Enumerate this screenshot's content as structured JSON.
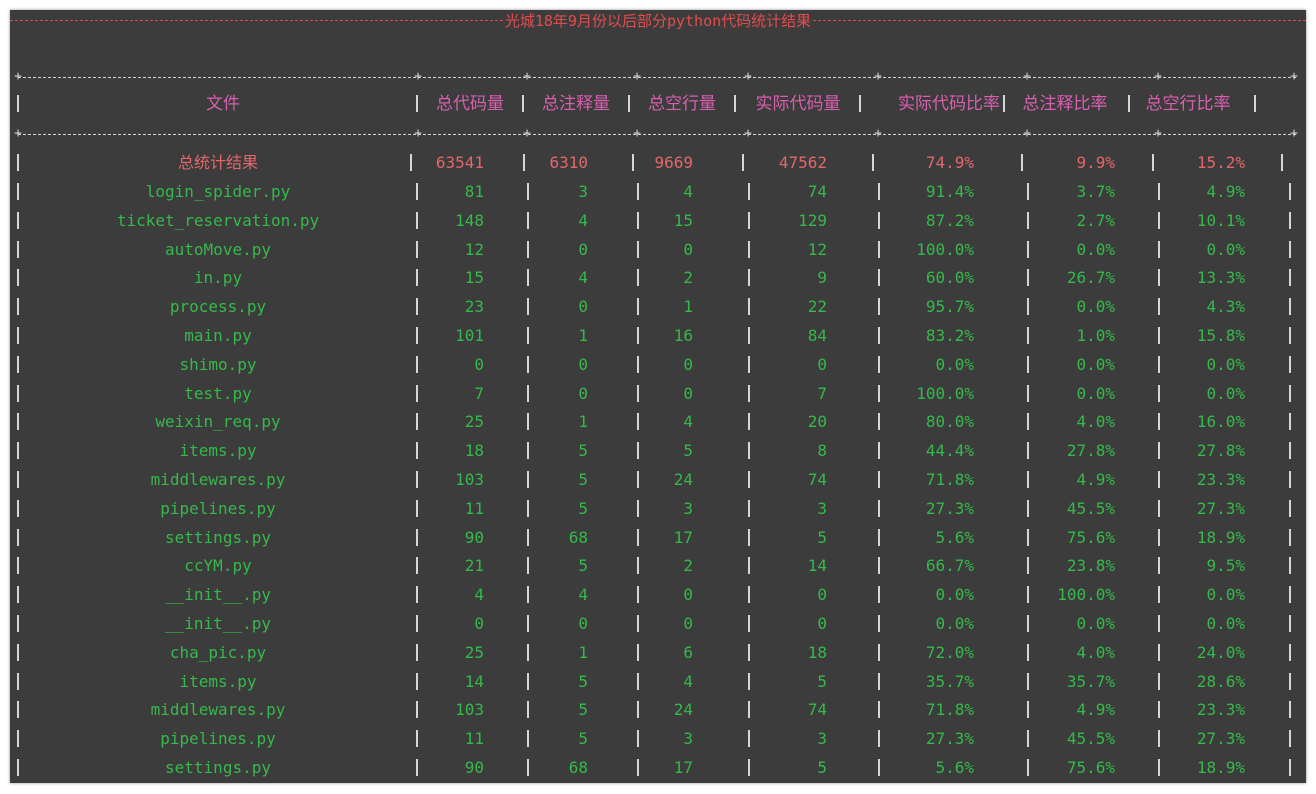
{
  "title": "光城18年9月份以后部分python代码统计结果",
  "headers": [
    "文件",
    "总代码量",
    "总注释量",
    "总空行量",
    "实际代码量",
    "实际代码比率",
    "总注释比率",
    "总空行比率"
  ],
  "summary": [
    "总统计结果",
    "63541",
    "6310",
    "9669",
    "47562",
    "74.9%",
    "9.9%",
    "15.2%"
  ],
  "rows": [
    [
      "login_spider.py",
      "81",
      "3",
      "4",
      "74",
      "91.4%",
      "3.7%",
      "4.9%"
    ],
    [
      "ticket_reservation.py",
      "148",
      "4",
      "15",
      "129",
      "87.2%",
      "2.7%",
      "10.1%"
    ],
    [
      "autoMove.py",
      "12",
      "0",
      "0",
      "12",
      "100.0%",
      "0.0%",
      "0.0%"
    ],
    [
      "in.py",
      "15",
      "4",
      "2",
      "9",
      "60.0%",
      "26.7%",
      "13.3%"
    ],
    [
      "process.py",
      "23",
      "0",
      "1",
      "22",
      "95.7%",
      "0.0%",
      "4.3%"
    ],
    [
      "main.py",
      "101",
      "1",
      "16",
      "84",
      "83.2%",
      "1.0%",
      "15.8%"
    ],
    [
      "shimo.py",
      "0",
      "0",
      "0",
      "0",
      "0.0%",
      "0.0%",
      "0.0%"
    ],
    [
      "test.py",
      "7",
      "0",
      "0",
      "7",
      "100.0%",
      "0.0%",
      "0.0%"
    ],
    [
      "weixin_req.py",
      "25",
      "1",
      "4",
      "20",
      "80.0%",
      "4.0%",
      "16.0%"
    ],
    [
      "items.py",
      "18",
      "5",
      "5",
      "8",
      "44.4%",
      "27.8%",
      "27.8%"
    ],
    [
      "middlewares.py",
      "103",
      "5",
      "24",
      "74",
      "71.8%",
      "4.9%",
      "23.3%"
    ],
    [
      "pipelines.py",
      "11",
      "5",
      "3",
      "3",
      "27.3%",
      "45.5%",
      "27.3%"
    ],
    [
      "settings.py",
      "90",
      "68",
      "17",
      "5",
      "5.6%",
      "75.6%",
      "18.9%"
    ],
    [
      "ccYM.py",
      "21",
      "5",
      "2",
      "14",
      "66.7%",
      "23.8%",
      "9.5%"
    ],
    [
      "__init__.py",
      "4",
      "4",
      "0",
      "0",
      "0.0%",
      "100.0%",
      "0.0%"
    ],
    [
      "__init__.py",
      "0",
      "0",
      "0",
      "0",
      "0.0%",
      "0.0%",
      "0.0%"
    ],
    [
      "cha_pic.py",
      "25",
      "1",
      "6",
      "18",
      "72.0%",
      "4.0%",
      "24.0%"
    ],
    [
      "items.py",
      "14",
      "5",
      "4",
      "5",
      "35.7%",
      "35.7%",
      "28.6%"
    ],
    [
      "middlewares.py",
      "103",
      "5",
      "24",
      "74",
      "71.8%",
      "4.9%",
      "23.3%"
    ],
    [
      "pipelines.py",
      "11",
      "5",
      "3",
      "3",
      "27.3%",
      "45.5%",
      "27.3%"
    ],
    [
      "settings.py",
      "90",
      "68",
      "17",
      "5",
      "5.6%",
      "75.6%",
      "18.9%"
    ]
  ],
  "colors": {
    "background": "#3c3c3c",
    "title": "#e24c4c",
    "header": "#d95fb0",
    "summary": "#e2676b",
    "data": "#35b94a",
    "border": "#d5d5d5"
  }
}
